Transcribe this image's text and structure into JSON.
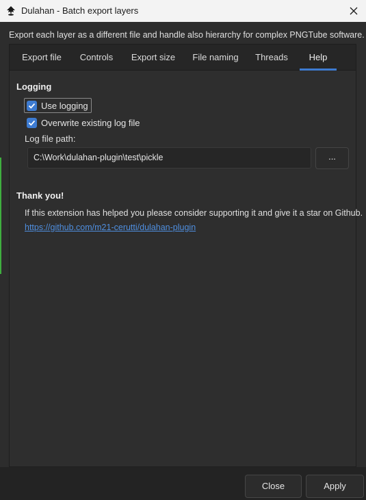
{
  "window": {
    "title": "Dulahan - Batch export layers",
    "app_icon": "inkscape-icon",
    "close_icon": "close-icon"
  },
  "description": "Export each layer as a different file and handle also hierarchy for complex PNGTube software.",
  "tabs": [
    {
      "label": "Export file"
    },
    {
      "label": "Controls"
    },
    {
      "label": "Export size"
    },
    {
      "label": "File naming"
    },
    {
      "label": "Threads"
    },
    {
      "label": "Help",
      "active": true
    }
  ],
  "logging": {
    "title": "Logging",
    "use_logging": {
      "label": "Use logging",
      "checked": true
    },
    "overwrite": {
      "label": "Overwrite existing log file",
      "checked": true
    },
    "path_label": "Log file path:",
    "path_value": "C:\\Work\\dulahan-plugin\\test\\pickle",
    "browse_label": "..."
  },
  "thanks": {
    "title": "Thank you!",
    "text": "If this extension has helped you please consider supporting it and give it a star on Github.",
    "link": "https://github.com/m21-cerutti/dulahan-plugin"
  },
  "footer": {
    "close_label": "Close",
    "apply_label": "Apply"
  },
  "colors": {
    "accent": "#3d7bd1",
    "link": "#4f8fe0",
    "background": "#2d2d2d"
  }
}
